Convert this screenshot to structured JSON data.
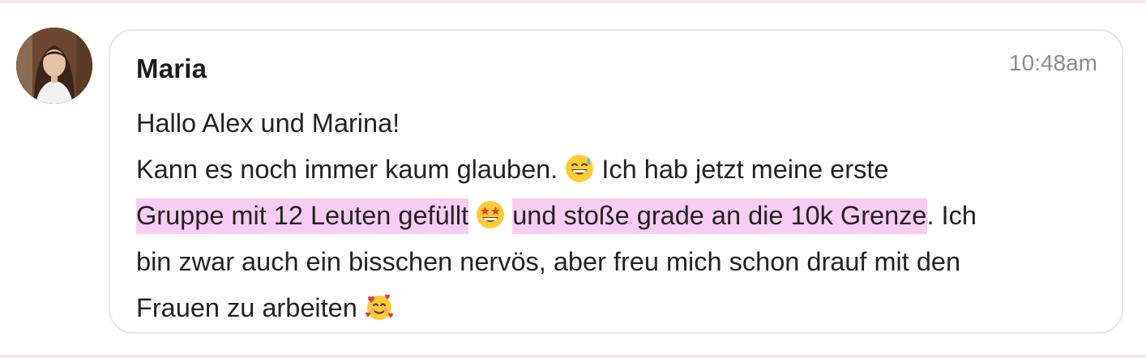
{
  "message": {
    "author": "Maria",
    "time": "10:48am",
    "greeting": "Hallo Alex und Marina!",
    "line1_text": "Kann es noch immer kaum glauben.",
    "line1_after": " Ich hab jetzt meine erste",
    "line2_highlight1": "Gruppe mit 12 Leuten gefüllt",
    "line2_highlight2": "und stoße grade an die 10k Grenze",
    "line2_after": ". Ich",
    "line3_text": "bin zwar auch ein bisschen nervös, aber freu mich schon drauf mit den",
    "line4_text": "Frauen zu arbeiten",
    "emojis": [
      "grinning-face-with-sweat",
      "star-struck",
      "smiling-face-with-hearts"
    ],
    "highlight_color": "#f7cdf4"
  }
}
